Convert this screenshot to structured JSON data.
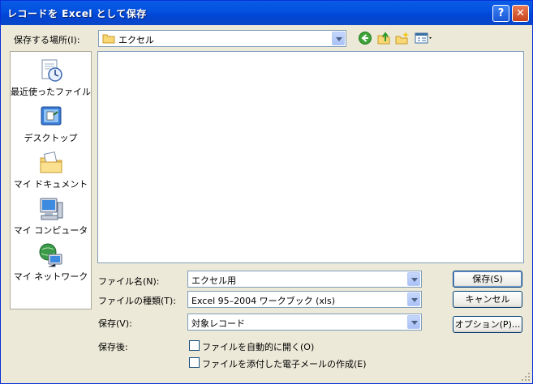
{
  "window": {
    "title": "レコードを Excel として保存"
  },
  "titlebar": {
    "help_label": "?",
    "close_label": "✕"
  },
  "save_in": {
    "label": "保存する場所(I):",
    "value": "エクセル"
  },
  "places": [
    {
      "label": "最近使ったファイル",
      "icon": "recent-documents-icon"
    },
    {
      "label": "デスクトップ",
      "icon": "desktop-icon"
    },
    {
      "label": "マイ ドキュメント",
      "icon": "my-documents-icon"
    },
    {
      "label": "マイ コンピュータ",
      "icon": "my-computer-icon"
    },
    {
      "label": "マイ ネットワーク",
      "icon": "my-network-icon"
    }
  ],
  "file_name": {
    "label": "ファイル名(N):",
    "value": "エクセル用"
  },
  "file_type": {
    "label": "ファイルの種類(T):",
    "value": "Excel 95–2004 ワークブック (xls)"
  },
  "save_scope": {
    "label": "保存(V):",
    "value": "対象レコード"
  },
  "after_save": {
    "label": "保存後:",
    "open_auto": "ファイルを自動的に開く(O)",
    "attach_email": "ファイルを添付した電子メールの作成(E)"
  },
  "buttons": {
    "save": "保存(S)",
    "cancel": "キャンセル",
    "options": "オプション(P)..."
  },
  "colors": {
    "titlebar": "#0054e3",
    "dialog_bg": "#ece9d8",
    "border": "#7f9db9"
  }
}
